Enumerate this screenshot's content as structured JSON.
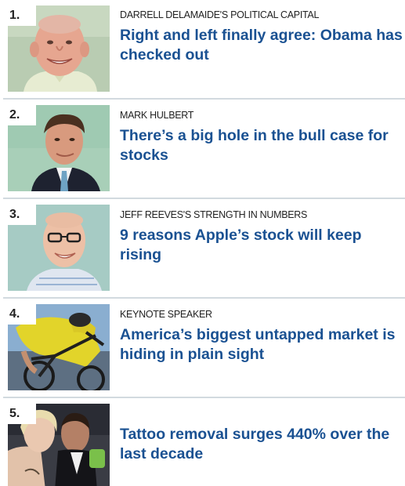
{
  "articles": [
    {
      "rank": "1.",
      "kicker": "DARRELL DELAMAIDE'S POLITICAL CAPITAL",
      "headline": "Right and left finally agree: Obama has checked out"
    },
    {
      "rank": "2.",
      "kicker": "MARK HULBERT",
      "headline": "There’s a big hole in the bull case for stocks"
    },
    {
      "rank": "3.",
      "kicker": "JEFF REEVES'S STRENGTH IN NUMBERS",
      "headline": "9 reasons Apple’s stock will keep rising"
    },
    {
      "rank": "4.",
      "kicker": "KEYNOTE SPEAKER",
      "headline": "America’s biggest untapped market is hiding in plain sight"
    },
    {
      "rank": "5.",
      "kicker": "",
      "headline": "Tattoo removal surges 440% over the last decade"
    }
  ],
  "colors": {
    "headline": "#1a5192",
    "kicker": "#222222",
    "divider": "#d2dadf"
  }
}
